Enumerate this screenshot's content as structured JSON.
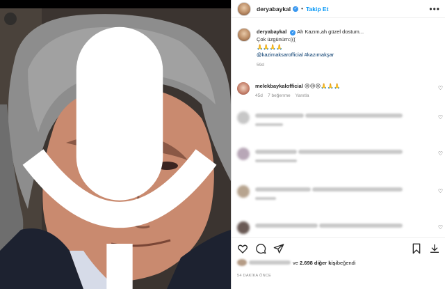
{
  "post": {
    "username": "deryabaykal",
    "verified_mark": "✓",
    "separator": "•",
    "follow_label": "Takip Et",
    "more_label": "•••"
  },
  "caption": {
    "username": "deryabaykal",
    "line1": "Ah Kazım,ah güzel dostum...",
    "line2": "Çok üzgünüm:(((",
    "line3": "🙏🙏🙏🙏",
    "tags": "@kazimaksarofficial #kazımakşar",
    "time": "59d"
  },
  "comments": [
    {
      "username": "melekbaykalofficial",
      "text": "😢😢😢🙏🙏🙏",
      "time": "45d",
      "likes": "7 beğenme",
      "reply": "Yanıtla"
    }
  ],
  "likes": {
    "suffix_pre": "ve ",
    "count": "2.698 diğer kişi",
    "suffix_post": " beğendi"
  },
  "timestamp": "54 DAKİKA ÖNCE",
  "icons": [
    "mute-icon",
    "heart-icon",
    "comment-icon",
    "share-icon",
    "bookmark-icon",
    "download-icon"
  ]
}
